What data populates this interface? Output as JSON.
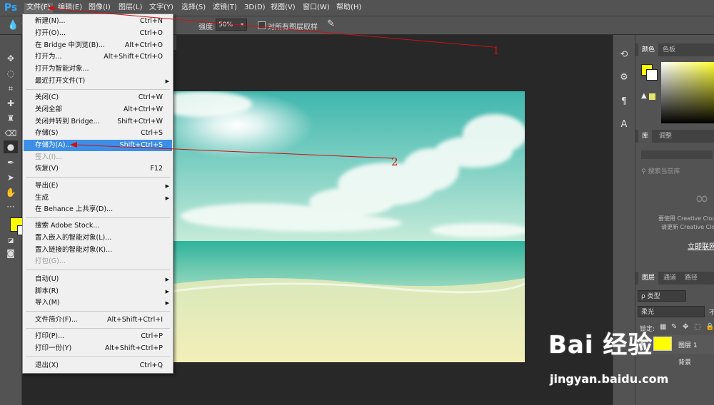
{
  "app": {
    "logo": "Ps"
  },
  "menubar": {
    "items": [
      {
        "label": "文件(F)",
        "active": true
      },
      {
        "label": "编辑(E)"
      },
      {
        "label": "图像(I)"
      },
      {
        "label": "图层(L)"
      },
      {
        "label": "文字(Y)"
      },
      {
        "label": "选择(S)"
      },
      {
        "label": "滤镜(T)"
      },
      {
        "label": "3D(D)"
      },
      {
        "label": "视图(V)"
      },
      {
        "label": "窗口(W)"
      },
      {
        "label": "帮助(H)"
      }
    ]
  },
  "options": {
    "strength_label": "强度:",
    "strength_value": "50%",
    "sample_all_label": "对所有图层取样",
    "sample_all_checked": false
  },
  "file_menu": {
    "items": [
      {
        "label": "新建(N)...",
        "shortcut": "Ctrl+N"
      },
      {
        "label": "打开(O)...",
        "shortcut": "Ctrl+O"
      },
      {
        "label": "在 Bridge 中浏览(B)...",
        "shortcut": "Alt+Ctrl+O"
      },
      {
        "label": "打开为...",
        "shortcut": "Alt+Shift+Ctrl+O"
      },
      {
        "label": "打开为智能对象..."
      },
      {
        "label": "最近打开文件(T)",
        "submenu": true
      },
      {
        "label": "关闭(C)",
        "shortcut": "Ctrl+W"
      },
      {
        "label": "关闭全部",
        "shortcut": "Alt+Ctrl+W"
      },
      {
        "label": "关闭并转到 Bridge...",
        "shortcut": "Shift+Ctrl+W"
      },
      {
        "label": "存储(S)",
        "shortcut": "Ctrl+S"
      },
      {
        "label": "存储为(A)...",
        "shortcut": "Shift+Ctrl+S",
        "highlighted": true
      },
      {
        "label": "签入(I)...",
        "disabled": true
      },
      {
        "label": "恢复(V)",
        "shortcut": "F12"
      },
      {
        "label": "导出(E)",
        "submenu": true
      },
      {
        "label": "生成",
        "submenu": true
      },
      {
        "label": "在 Behance 上共享(D)..."
      },
      {
        "label": "搜索 Adobe Stock..."
      },
      {
        "label": "置入嵌入的智能对象(L)..."
      },
      {
        "label": "置入链接的智能对象(K)..."
      },
      {
        "label": "打包(G)...",
        "disabled": true
      },
      {
        "label": "自动(U)",
        "submenu": true
      },
      {
        "label": "脚本(R)",
        "submenu": true
      },
      {
        "label": "导入(M)",
        "submenu": true
      },
      {
        "label": "文件简介(F)...",
        "shortcut": "Alt+Shift+Ctrl+I"
      },
      {
        "label": "打印(P)...",
        "shortcut": "Ctrl+P"
      },
      {
        "label": "打印一份(Y)",
        "shortcut": "Alt+Shift+Ctrl+P"
      },
      {
        "label": "退出(X)",
        "shortcut": "Ctrl+Q"
      }
    ]
  },
  "color_panel": {
    "tabs": [
      "颜色",
      "色板"
    ],
    "foreground": "#ffff00",
    "background": "#ffffff"
  },
  "library_panel": {
    "tabs": [
      "库",
      "调整"
    ],
    "search_placeholder": "搜索当前库",
    "message_line1": "要使用 Creative Cloud",
    "message_line2": "请更新 Creative Cloud",
    "link": "立即联网"
  },
  "layers_panel": {
    "tabs": [
      "图层",
      "通道",
      "路径"
    ],
    "kind_label": "ρ 类型",
    "blend_mode": "柔光",
    "opacity_label": "不",
    "lock_label": "锁定:",
    "layers": [
      {
        "name": "图层 1",
        "color": "#ffff00"
      },
      {
        "name": "背景"
      }
    ]
  },
  "annotations": [
    "1",
    "2"
  ],
  "watermark": {
    "brand": "Bai 经验",
    "url": "jingyan.baidu.com"
  }
}
